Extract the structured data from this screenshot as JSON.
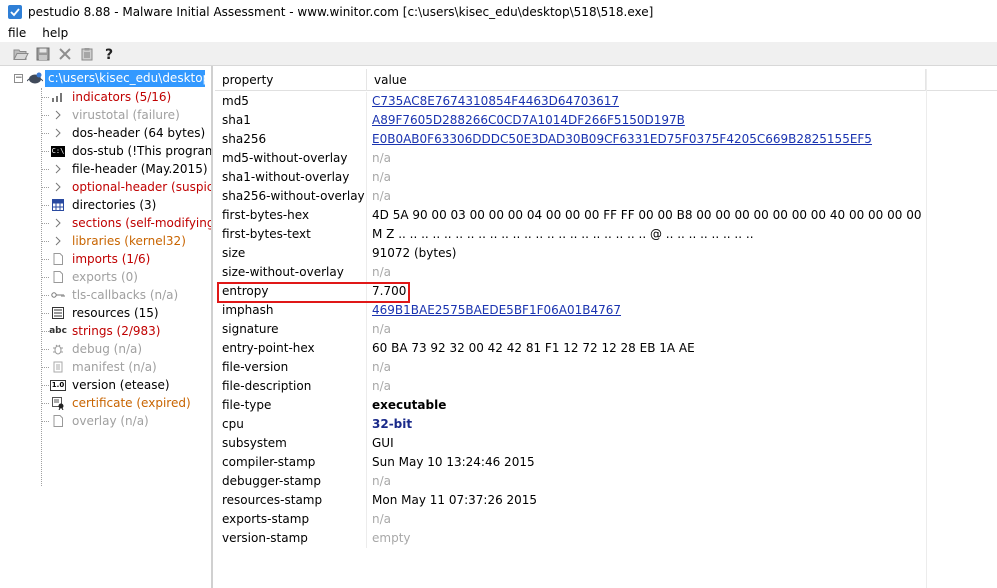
{
  "window": {
    "title": "pestudio 8.88 - Malware Initial Assessment - www.winitor.com [c:\\users\\kisec_edu\\desktop\\518\\518.exe]"
  },
  "menu": [
    "file",
    "help"
  ],
  "toolbar": {
    "icons": [
      "open-icon",
      "save-icon",
      "close-icon",
      "clipboard-icon",
      "help-icon"
    ]
  },
  "tree": {
    "root_label": "c:\\users\\kisec_edu\\desktop\\518\\518.exe",
    "expander": "−",
    "items": [
      {
        "label": "indicators (5/16)",
        "color": "red",
        "icon": "bar-chart-icon"
      },
      {
        "label": "virustotal (failure)",
        "color": "gray",
        "icon": "arrow-icon"
      },
      {
        "label": "dos-header (64 bytes)",
        "color": "black",
        "icon": "arrow-icon"
      },
      {
        "label": "dos-stub (!This program c",
        "color": "black",
        "icon": "console-icon"
      },
      {
        "label": "file-header (May.2015)",
        "color": "black",
        "icon": "arrow-icon"
      },
      {
        "label": "optional-header (suspiciou",
        "color": "red",
        "icon": "arrow-icon"
      },
      {
        "label": "directories (3)",
        "color": "black",
        "icon": "grid-icon"
      },
      {
        "label": "sections (self-modifying)",
        "color": "red",
        "icon": "arrow-icon"
      },
      {
        "label": "libraries (kernel32)",
        "color": "orange",
        "icon": "arrow-icon"
      },
      {
        "label": "imports (1/6)",
        "color": "red",
        "icon": "document-icon"
      },
      {
        "label": "exports (0)",
        "color": "gray",
        "icon": "document-icon"
      },
      {
        "label": "tls-callbacks (n/a)",
        "color": "gray",
        "icon": "key-icon"
      },
      {
        "label": "resources (15)",
        "color": "black",
        "icon": "list-icon"
      },
      {
        "label": "strings (2/983)",
        "color": "red",
        "icon": "abc-icon"
      },
      {
        "label": "debug (n/a)",
        "color": "gray",
        "icon": "bug-icon"
      },
      {
        "label": "manifest (n/a)",
        "color": "gray",
        "icon": "manifest-icon"
      },
      {
        "label": "version (etease)",
        "color": "black",
        "icon": "version-icon"
      },
      {
        "label": "certificate (expired)",
        "color": "orange",
        "icon": "certificate-icon"
      },
      {
        "label": "overlay (n/a)",
        "color": "gray",
        "icon": "document-icon"
      }
    ],
    "abc_text": "abc",
    "version_text": "1.0",
    "console_text": "C:\\"
  },
  "table": {
    "headers": {
      "property": "property",
      "value": "value"
    },
    "rows": [
      {
        "property": "md5",
        "value": "C735AC8E7674310854F4463D64703617",
        "style": "link"
      },
      {
        "property": "sha1",
        "value": "A89F7605D288266C0CD7A1014DF266F5150D197B",
        "style": "link"
      },
      {
        "property": "sha256",
        "value": "E0B0AB0F63306DDDC50E3DAD30B09CF6331ED75F0375F4205C669B2825155EF5",
        "style": "link"
      },
      {
        "property": "md5-without-overlay",
        "value": "n/a",
        "style": "na"
      },
      {
        "property": "sha1-without-overlay",
        "value": "n/a",
        "style": "na"
      },
      {
        "property": "sha256-without-overlay",
        "value": "n/a",
        "style": "na"
      },
      {
        "property": "first-bytes-hex",
        "value": "4D 5A 90 00 03 00 00 00 04 00 00 00 FF FF 00 00 B8 00 00 00 00 00 00 00 40 00 00 00 00 00 ...",
        "style": "plain"
      },
      {
        "property": "first-bytes-text",
        "value": "M Z .. .. .. .. .. .. .. .. .. .. .. .. .. .. .. .. .. .. .. .. .. .. @ .. .. .. .. .. .. .. ..",
        "style": "plain"
      },
      {
        "property": "size",
        "value": "91072 (bytes)",
        "style": "plain"
      },
      {
        "property": "size-without-overlay",
        "value": "n/a",
        "style": "na"
      },
      {
        "property": "entropy",
        "value": "7.700",
        "style": "plain"
      },
      {
        "property": "imphash",
        "value": "469B1BAE2575BAEDE5BF1F06A01B4767",
        "style": "link"
      },
      {
        "property": "signature",
        "value": "n/a",
        "style": "na"
      },
      {
        "property": "entry-point-hex",
        "value": "60 BA 73 92 32 00 42 42 81 F1 12 72 12 28 EB 1A AE",
        "style": "plain"
      },
      {
        "property": "file-version",
        "value": "n/a",
        "style": "na"
      },
      {
        "property": "file-description",
        "value": "n/a",
        "style": "na"
      },
      {
        "property": "file-type",
        "value": "executable",
        "style": "bold"
      },
      {
        "property": "cpu",
        "value": "32-bit",
        "style": "cpu"
      },
      {
        "property": "subsystem",
        "value": "GUI",
        "style": "plain"
      },
      {
        "property": "compiler-stamp",
        "value": "Sun May 10 13:24:46 2015",
        "style": "plain"
      },
      {
        "property": "debugger-stamp",
        "value": "n/a",
        "style": "na"
      },
      {
        "property": "resources-stamp",
        "value": "Mon May 11 07:37:26 2015",
        "style": "plain"
      },
      {
        "property": "exports-stamp",
        "value": "n/a",
        "style": "na"
      },
      {
        "property": "version-stamp",
        "value": "empty",
        "style": "na"
      }
    ],
    "highlighted_property": "entropy",
    "highlight_color": "#e01818"
  },
  "colors": {
    "selection": "#3399ff",
    "link": "#1a33b0",
    "warning_red": "#c00000",
    "caution_orange": "#c86400",
    "disabled_gray": "#a0a0a0"
  }
}
